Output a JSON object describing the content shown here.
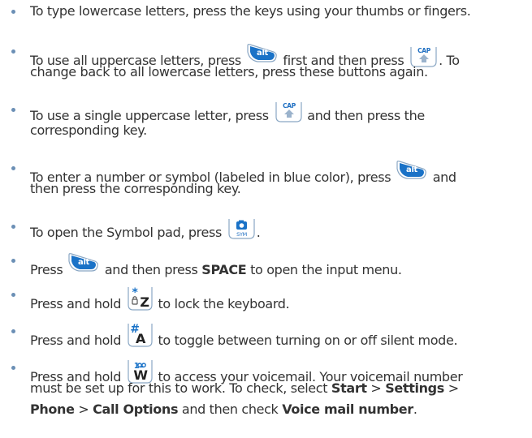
{
  "items": [
    {
      "lines": [
        [
          {
            "t": "To type lowercase letters, press the keys using your thumbs or fingers."
          }
        ]
      ]
    },
    {
      "lines": [
        [
          {
            "t": "To use all uppercase letters, press "
          },
          {
            "key": "alt"
          },
          {
            "t": " first and then press "
          },
          {
            "key": "cap"
          },
          {
            "t": ". To"
          }
        ],
        [
          {
            "t": "change back to all lowercase letters, press these buttons again."
          }
        ]
      ]
    },
    {
      "lines": [
        [
          {
            "t": "To use a single uppercase letter, press "
          },
          {
            "key": "cap"
          },
          {
            "t": " and then press the"
          }
        ],
        [
          {
            "t": "corresponding key."
          }
        ]
      ]
    },
    {
      "lines": [
        [
          {
            "t": "To enter a number or symbol (labeled in blue color), press "
          },
          {
            "key": "alt"
          },
          {
            "t": " and"
          }
        ],
        [
          {
            "t": "then press the corresponding key."
          }
        ]
      ]
    },
    {
      "lines": [
        [
          {
            "t": "To open the Symbol pad, press "
          },
          {
            "key": "sym"
          },
          {
            "t": "."
          }
        ]
      ]
    },
    {
      "lines": [
        [
          {
            "t": "Press "
          },
          {
            "key": "alt"
          },
          {
            "t": " and then press "
          },
          {
            "b": "SPACE"
          },
          {
            "t": " to open the input menu."
          }
        ]
      ]
    },
    {
      "lines": [
        [
          {
            "t": "Press and hold "
          },
          {
            "key": "starz"
          },
          {
            "t": " to lock the keyboard."
          }
        ]
      ]
    },
    {
      "lines": [
        [
          {
            "t": "Press and hold "
          },
          {
            "key": "hasha"
          },
          {
            "t": " to toggle between turning on or off silent mode."
          }
        ]
      ]
    },
    {
      "lines": [
        [
          {
            "t": "Press and hold "
          },
          {
            "key": "vmw"
          },
          {
            "t": " to access your voicemail. Your voicemail number"
          }
        ],
        [
          {
            "t": "must be set up for this to work. To check, select "
          },
          {
            "b": "Start"
          },
          {
            "t": " > "
          },
          {
            "b": "Settings"
          },
          {
            "t": " >"
          }
        ],
        [
          {
            "b": "Phone"
          },
          {
            "t": " > "
          },
          {
            "b": "Call Options"
          },
          {
            "t": " and then check "
          },
          {
            "b": "Voice mail number"
          },
          {
            "t": "."
          }
        ]
      ]
    }
  ],
  "keys": {
    "alt": {
      "glyph": "alt",
      "icon": "alt-key-icon"
    },
    "cap": {
      "glyph": "CAP",
      "icon": "cap-shift-key-icon"
    },
    "sym": {
      "glyph": "SYM",
      "icon": "sym-camera-key-icon"
    },
    "starz": {
      "glyph_top": "*",
      "glyph": "Z",
      "icon": "star-z-lock-key-icon"
    },
    "hasha": {
      "glyph_top": "#",
      "glyph": "A",
      "icon": "hash-a-key-icon"
    },
    "vmw": {
      "glyph_top": "1",
      "glyph": "W",
      "icon": "voicemail-w-key-icon"
    }
  },
  "colors": {
    "text": "#333333",
    "bullet": "#6b8fb5",
    "alt_blue": "#1a72c7",
    "key_border": "#8aa7c4",
    "cap_label": "#1f6fc2"
  }
}
